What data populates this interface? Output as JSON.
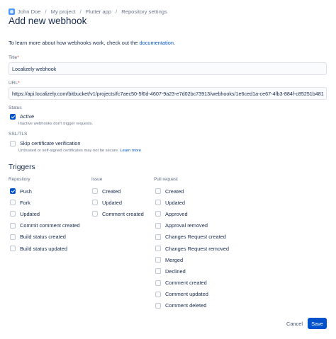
{
  "breadcrumbs": [
    "John Doe",
    "My project",
    "Flutter app",
    "Repository settings"
  ],
  "breadcrumb_separator": "/",
  "page_title": "Add new webhook",
  "intro": {
    "text": "To learn more about how webhooks work, check out the ",
    "link": "documentation",
    "suffix": "."
  },
  "title_field": {
    "label": "Title",
    "required_mark": "*",
    "value": "Localizely webhook"
  },
  "url_field": {
    "label": "URL",
    "required_mark": "*",
    "value": "https://api.localizely.com/bitbucket/v1/projects/fc7aec50-5f0d-4607-9a23-e7d02bc73913/webhooks/1e6ced1a-ce67-4fb3-884f-c85251b481"
  },
  "status": {
    "label": "Status",
    "option": "Active",
    "checked": true,
    "hint": "Inactive webhooks don't trigger requests."
  },
  "ssl": {
    "label": "SSL/TLS",
    "option": "Skip certificate verification",
    "checked": false,
    "hint": "Untrusted or self-signed certificates may not be secure. ",
    "hint_link": "Learn more"
  },
  "triggers": {
    "title": "Triggers",
    "repository": {
      "header": "Repository",
      "items": [
        {
          "label": "Push",
          "checked": true
        },
        {
          "label": "Fork",
          "checked": false
        },
        {
          "label": "Updated",
          "checked": false
        },
        {
          "label": "Commit comment created",
          "checked": false
        },
        {
          "label": "Build status created",
          "checked": false
        },
        {
          "label": "Build status updated",
          "checked": false
        }
      ]
    },
    "issue": {
      "header": "Issue",
      "items": [
        {
          "label": "Created",
          "checked": false
        },
        {
          "label": "Updated",
          "checked": false
        },
        {
          "label": "Comment created",
          "checked": false
        }
      ]
    },
    "pull_request": {
      "header": "Pull request",
      "items": [
        {
          "label": "Created",
          "checked": false
        },
        {
          "label": "Updated",
          "checked": false
        },
        {
          "label": "Approved",
          "checked": false
        },
        {
          "label": "Approval removed",
          "checked": false
        },
        {
          "label": "Changes Request created",
          "checked": false
        },
        {
          "label": "Changes Request removed",
          "checked": false
        },
        {
          "label": "Merged",
          "checked": false
        },
        {
          "label": "Declined",
          "checked": false
        },
        {
          "label": "Comment created",
          "checked": false
        },
        {
          "label": "Comment updated",
          "checked": false
        },
        {
          "label": "Comment deleted",
          "checked": false
        }
      ]
    }
  },
  "buttons": {
    "cancel": "Cancel",
    "save": "Save"
  },
  "colors": {
    "primary": "#0052cc",
    "text": "#172b4d",
    "muted": "#6b778c",
    "required": "#de350b"
  }
}
